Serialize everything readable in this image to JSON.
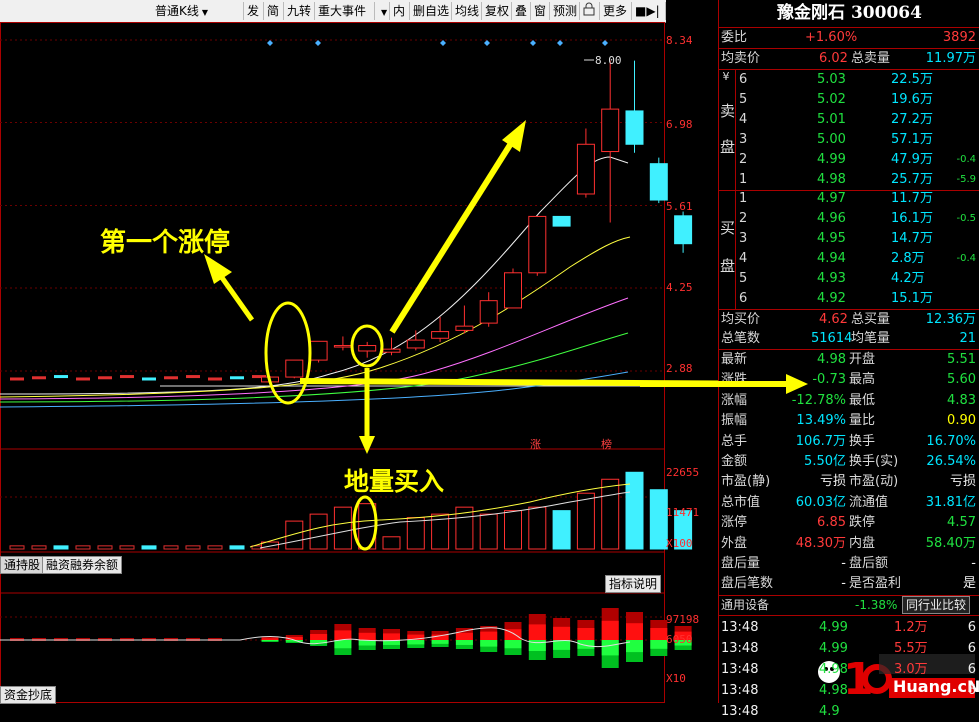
{
  "toolbar": {
    "kline_type": "普通K线",
    "items": [
      "发",
      "简",
      "九转",
      "重大事件",
      "内",
      "删自选",
      "均线",
      "复权",
      "叠",
      "窗",
      "预测",
      "更多"
    ]
  },
  "chart": {
    "price_ticks": [
      "8.34",
      "6.98",
      "5.61",
      "4.25",
      "2.88"
    ],
    "vol_ticks": [
      "22655",
      "11471",
      "X100"
    ],
    "ind_ticks": [
      "97198",
      "6050",
      "X10"
    ],
    "high_label": "8.00",
    "markers": [
      "涨",
      "榜"
    ],
    "annotations": {
      "first_limit": "第一个涨停",
      "low_volume": "地量买入"
    },
    "tabs": {
      "hold": "通持股",
      "margin": "融资融券余额",
      "indicator": "指标说明",
      "fund": "资金抄底"
    }
  },
  "chart_data": {
    "type": "candlestick",
    "candles": [
      {
        "o": 2.7,
        "c": 2.78,
        "h": 2.8,
        "l": 2.66,
        "v": 2000
      },
      {
        "o": 2.78,
        "c": 3.06,
        "h": 3.06,
        "l": 2.76,
        "v": 8000
      },
      {
        "o": 3.06,
        "c": 3.37,
        "h": 3.37,
        "l": 3.02,
        "v": 10000
      },
      {
        "o": 3.3,
        "c": 3.3,
        "h": 3.45,
        "l": 3.22,
        "v": 12000
      },
      {
        "o": 3.21,
        "c": 3.3,
        "h": 3.36,
        "l": 3.1,
        "v": 13000
      },
      {
        "o": 3.19,
        "c": 3.24,
        "h": 3.43,
        "l": 3.14,
        "v": 3500
      },
      {
        "o": 3.26,
        "c": 3.39,
        "h": 3.55,
        "l": 3.22,
        "v": 9000
      },
      {
        "o": 3.42,
        "c": 3.53,
        "h": 3.77,
        "l": 3.36,
        "v": 10000
      },
      {
        "o": 3.55,
        "c": 3.62,
        "h": 3.96,
        "l": 3.5,
        "v": 12000
      },
      {
        "o": 3.67,
        "c": 4.04,
        "h": 4.18,
        "l": 3.61,
        "v": 10000
      },
      {
        "o": 3.92,
        "c": 4.5,
        "h": 4.57,
        "l": 3.92,
        "v": 11000
      },
      {
        "o": 4.5,
        "c": 5.43,
        "h": 5.43,
        "l": 4.45,
        "v": 12000
      },
      {
        "o": 5.43,
        "c": 5.27,
        "h": 5.43,
        "l": 5.27,
        "v": 11000
      },
      {
        "o": 5.8,
        "c": 6.62,
        "h": 6.88,
        "l": 5.74,
        "v": 16000
      },
      {
        "o": 6.5,
        "c": 7.2,
        "h": 8.0,
        "l": 5.33,
        "v": 20000
      },
      {
        "o": 7.17,
        "c": 6.62,
        "h": 8.0,
        "l": 6.48,
        "v": 22000
      },
      {
        "o": 6.3,
        "c": 5.7,
        "h": 6.4,
        "l": 5.65,
        "v": 17000
      },
      {
        "o": 5.44,
        "c": 4.98,
        "h": 5.51,
        "l": 4.83,
        "v": 11000
      }
    ]
  },
  "quote": {
    "title": "豫金刚石  300064",
    "weibi": {
      "label": "委比",
      "pct": "+1.60%",
      "val": "3892"
    },
    "avg_sell": {
      "label": "均卖价",
      "val": "6.02",
      "label2": "总卖量",
      "val2": "11.97万"
    },
    "sell_side_label": [
      "卖",
      "盘"
    ],
    "buy_side_label": [
      "买",
      "盘"
    ],
    "sells": [
      {
        "n": "6",
        "p": "5.03",
        "v": "22.5万",
        "d": ""
      },
      {
        "n": "5",
        "p": "5.02",
        "v": "19.6万",
        "d": ""
      },
      {
        "n": "4",
        "p": "5.01",
        "v": "27.2万",
        "d": ""
      },
      {
        "n": "3",
        "p": "5.00",
        "v": "57.1万",
        "d": ""
      },
      {
        "n": "2",
        "p": "4.99",
        "v": "47.9万",
        "d": "-0.4"
      },
      {
        "n": "1",
        "p": "4.98",
        "v": "25.7万",
        "d": "-5.9"
      }
    ],
    "buys": [
      {
        "n": "1",
        "p": "4.97",
        "v": "11.7万",
        "d": ""
      },
      {
        "n": "2",
        "p": "4.96",
        "v": "16.1万",
        "d": "-0.5"
      },
      {
        "n": "3",
        "p": "4.95",
        "v": "14.7万",
        "d": ""
      },
      {
        "n": "4",
        "p": "4.94",
        "v": "2.8万",
        "d": "-0.4"
      },
      {
        "n": "5",
        "p": "4.93",
        "v": "4.2万",
        "d": ""
      },
      {
        "n": "6",
        "p": "4.92",
        "v": "15.1万",
        "d": ""
      }
    ],
    "avg_buy": {
      "label": "均买价",
      "val": "4.62",
      "label2": "总买量",
      "val2": "12.36万"
    },
    "total_trades": {
      "label": "总笔数",
      "val": "51614",
      "label2": "均笔量",
      "val2": "21"
    },
    "stats": [
      {
        "l1": "最新",
        "v1": "4.98",
        "c1": "grn",
        "l2": "开盘",
        "v2": "5.51",
        "c2": "grn"
      },
      {
        "l1": "涨跌",
        "v1": "-0.73",
        "c1": "grn",
        "l2": "最高",
        "v2": "5.60",
        "c2": "grn"
      },
      {
        "l1": "涨幅",
        "v1": "-12.78%",
        "c1": "grn",
        "l2": "最低",
        "v2": "4.83",
        "c2": "grn"
      },
      {
        "l1": "振幅",
        "v1": "13.49%",
        "c1": "cyn",
        "l2": "量比",
        "v2": "0.90",
        "c2": "yel"
      },
      {
        "l1": "总手",
        "v1": "106.7万",
        "c1": "cyn",
        "l2": "换手",
        "v2": "16.70%",
        "c2": "cyn"
      },
      {
        "l1": "金额",
        "v1": "5.50亿",
        "c1": "cyn",
        "l2": "换手(实)",
        "v2": "26.54%",
        "c2": "cyn"
      },
      {
        "l1": "市盈(静)",
        "v1": "亏损",
        "c1": "wht",
        "l2": "市盈(动)",
        "v2": "亏损",
        "c2": "wht"
      },
      {
        "l1": "总市值",
        "v1": "60.03亿",
        "c1": "cyn",
        "l2": "流通值",
        "v2": "31.81亿",
        "c2": "cyn"
      },
      {
        "l1": "涨停",
        "v1": "6.85",
        "c1": "red",
        "l2": "跌停",
        "v2": "4.57",
        "c2": "grn"
      },
      {
        "l1": "外盘",
        "v1": "48.30万",
        "c1": "red",
        "l2": "内盘",
        "v2": "58.40万",
        "c2": "grn"
      },
      {
        "l1": "盘后量",
        "v1": "-",
        "c1": "wht",
        "l2": "盘后额",
        "v2": "-",
        "c2": "wht"
      },
      {
        "l1": "盘后笔数",
        "v1": "-",
        "c1": "wht",
        "l2": "是否盈利",
        "v2": "是",
        "c2": "wht"
      }
    ],
    "sector": {
      "label": "通用设备",
      "pct": "-1.38%",
      "btn": "同行业比较"
    },
    "ticks": [
      {
        "t": "13:48",
        "p": "4.99",
        "v": "1.2万",
        "n": "6"
      },
      {
        "t": "13:48",
        "p": "4.99",
        "v": "5.5万",
        "n": "6"
      },
      {
        "t": "13:48",
        "p": "4.98",
        "v": "3.0万",
        "n": "6"
      },
      {
        "t": "13:48",
        "p": "4.98",
        "v": "",
        "n": "6"
      },
      {
        "t": "13:48",
        "p": "4.9",
        "v": "",
        "n": ""
      }
    ],
    "watermark": "Huang.cN"
  }
}
